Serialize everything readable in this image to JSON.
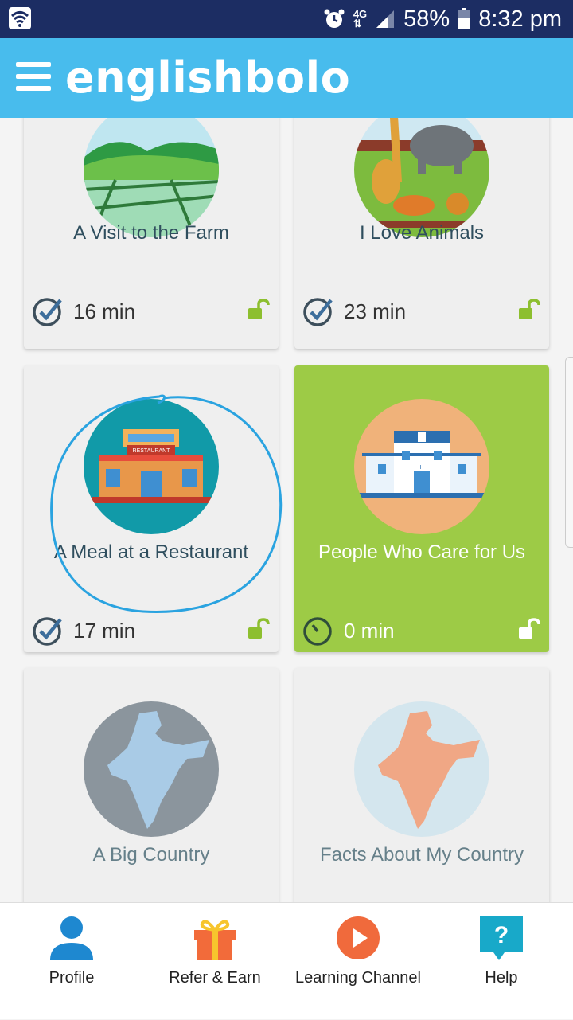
{
  "status_bar": {
    "network": "4G",
    "battery": "58%",
    "time": "8:32 pm"
  },
  "app": {
    "logo": "englishbolo"
  },
  "cards": [
    {
      "title": "A Visit to the Farm",
      "time": "16 min",
      "status": "completed"
    },
    {
      "title": "I Love Animals",
      "time": "23 min",
      "status": "completed"
    },
    {
      "title": "A Meal at a Restaurant",
      "time": "17 min",
      "status": "completed",
      "restaurant_sign": "RESTAURANT"
    },
    {
      "title": "People Who Care for Us",
      "time": "0 min",
      "status": "in-progress",
      "hospital_sign": "H"
    },
    {
      "title": "A Big Country",
      "status": "locked"
    },
    {
      "title": "Facts About My Country",
      "status": "locked"
    }
  ],
  "bottom_nav": [
    {
      "label": "Profile",
      "icon": "profile-icon"
    },
    {
      "label": "Refer & Earn",
      "icon": "gift-icon"
    },
    {
      "label": "Learning Channel",
      "icon": "play-icon"
    },
    {
      "label": "Help",
      "icon": "help-icon",
      "glyph": "?"
    }
  ],
  "colors": {
    "status_bar": "#1c2d63",
    "app_bar": "#48bced",
    "active_card": "#9dcb46",
    "lock_green": "#8dbf2f",
    "annotation_circle": "#2aa3e0"
  }
}
